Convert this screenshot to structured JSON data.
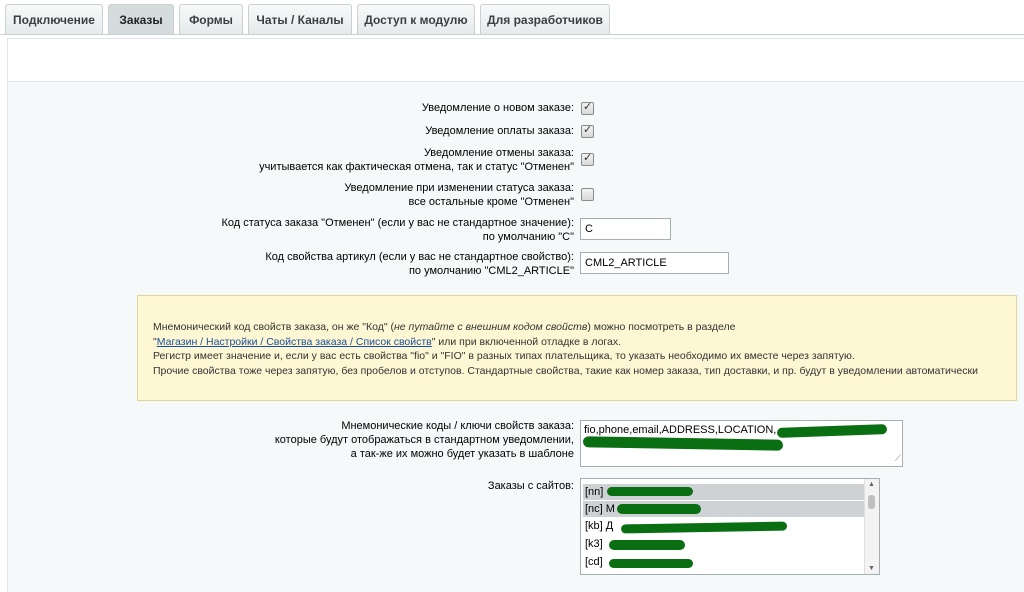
{
  "tabs": [
    {
      "label": "Подключение"
    },
    {
      "label": "Заказы"
    },
    {
      "label": "Формы"
    },
    {
      "label": "Чаты / Каналы"
    },
    {
      "label": "Доступ к модулю"
    },
    {
      "label": "Для разработчиков"
    }
  ],
  "active_tab": "Заказы",
  "settings": {
    "new_order_label": "Уведомление о новом заказе:",
    "new_order_checked": true,
    "payment_label": "Уведомление оплаты заказа:",
    "payment_checked": true,
    "cancel_label_1": "Уведомление отмены заказа:",
    "cancel_label_2": "учитывается как фактическая отмена, так и статус \"Отменен\"",
    "cancel_checked": true,
    "status_change_label_1": "Уведомление при изменении статуса заказа:",
    "status_change_label_2": "все остальные кроме \"Отменен\"",
    "status_change_checked": false,
    "cancel_code_label_1": "Код статуса заказа \"Отменен\" (если у вас не стандартное значение):",
    "cancel_code_label_2": "по умолчанию \"С\"",
    "cancel_code_value": "С",
    "article_label_1": "Код свойства артикул (если у вас не стандартное свойство):",
    "article_label_2": "по умолчанию \"CML2_ARTICLE\"",
    "article_value": "CML2_ARTICLE"
  },
  "note": {
    "line1_a": "Мнемонический код свойств заказа, он же \"Код\" (",
    "line1_em": "не путайте с внешним кодом свойств",
    "line1_b": ") можно посмотреть в разделе",
    "link_pre": "\"",
    "link_text": "Магазин / Настройки / Свойства заказа / Список свойств",
    "link_post": "\" или при включенной отладке в логах.",
    "line3": "Регистр имеет значение и, если у вас есть свойства \"fio\" и \"FIO\" в разных типах плательщика, то указать необходимо их вместе через запятую.",
    "line4": "Прочие свойства тоже через запятую, без пробелов и отступов. Стандартные свойства, такие как номер заказа, тип доставки, и пр. будут в уведомлении автоматически"
  },
  "props": {
    "label_1": "Мнемонические коды / ключи свойств заказа:",
    "label_2": "которые будут отображаться в стандартном уведомлении,",
    "label_3": "а так-же их можно будет указать в шаблоне",
    "value_visible": "fio,phone,email,ADDRESS,LOCATION,"
  },
  "sites": {
    "label": "Заказы с сайтов:",
    "options": [
      {
        "code": "[nn]",
        "selected": true
      },
      {
        "code": "[nc]",
        "text": "M",
        "selected": true
      },
      {
        "code": "[kb]",
        "text": "Д",
        "selected": false
      },
      {
        "code": "[k3]",
        "selected": false
      },
      {
        "code": "[cd]",
        "selected": false
      }
    ]
  },
  "icons": {
    "checkbox_mark": "✓",
    "resize_handle": "⟋",
    "scroll_up": "▲",
    "scroll_down": "▼"
  }
}
